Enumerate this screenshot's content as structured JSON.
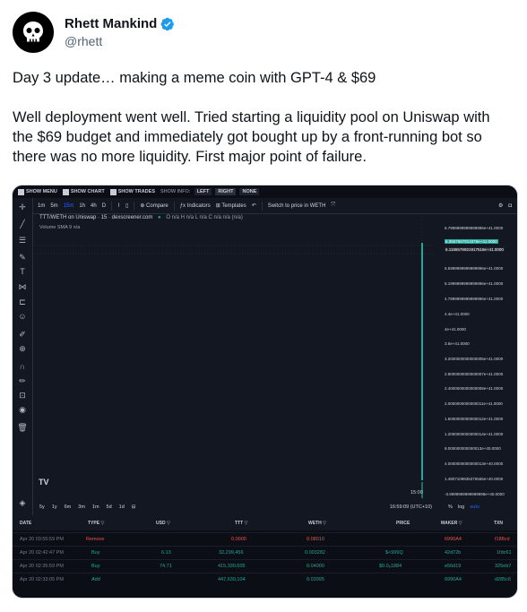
{
  "user": {
    "name": "Rhett Mankind",
    "handle": "@rhett",
    "verified_color": "#1d9bf0",
    "avatar_icon": "skull-icon"
  },
  "tweet": {
    "line1": "Day 3 update… making a meme coin with GPT-4 & $69",
    "line2": "Well deployment went well. Tried starting a liquidity pool on Uniswap with the $69 budget and immediately got bought up by a front-running bot so there was no more liquidity. First major point of failure."
  },
  "chart": {
    "topbar": {
      "show_menu": "SHOW MENU",
      "show_chart": "SHOW CHART",
      "show_trades": "SHOW TRADES",
      "show_info": "SHOW INFO:",
      "left": "LEFT",
      "right": "RIGHT",
      "none": "NONE"
    },
    "timeframes": [
      "1m",
      "5m",
      "15m",
      "1h",
      "4h",
      "D"
    ],
    "active_timeframe": "15m",
    "toolbar": {
      "compare": "Compare",
      "indicators": "Indicators",
      "templates": "Templates",
      "switch_price": "Switch to price in WETH"
    },
    "legend_title": "TTT/WETH on Uniswap · 15 · dexscreener.com",
    "legend_ohlc": "O n/a  H n/a  L n/a  C n/a  n/a (n/a)",
    "volume_label": "Volume  SMA 9  n/a",
    "watermark": "TV",
    "price_labels": [
      "6.7999999999999996e+41.0000",
      "6.3567567913376e+41.0000",
      "6.1186579921917518e+41.0000",
      "5.5999999999999996e+41.0000",
      "5.1999999999999996e+41.0000",
      "4.7999999999999996e+41.0000",
      "4.4e+41.0000",
      "4e+41.0000",
      "3.6e+41.0000",
      "3.2000000000000005e+41.0000",
      "2.8000000000000007e+41.0000",
      "2.4000000000000008e+41.0000",
      "2.0000000000000011e+41.0000",
      "1.6000000000000012e+41.0000",
      "1.2000000000000014e+41.0000",
      "8.000000000000013e+40.0000",
      "4.0000000000000013e+40.0000",
      "1.4807109835375555e+40.0000",
      "-3.9999999999999998e+40.0000"
    ],
    "time_label": "15:00",
    "ranges": [
      "5y",
      "1y",
      "6m",
      "3m",
      "1m",
      "5d",
      "1d"
    ],
    "clock": "16:59:09 (UTC+10)",
    "scale_opts": [
      "%",
      "log",
      "auto"
    ],
    "accent_color": "#26a69a"
  },
  "trades": {
    "headers": [
      "DATE",
      "TYPE",
      "USD",
      "TTT",
      "WETH",
      "PRICE",
      "MAKER",
      "TXN"
    ],
    "rows": [
      {
        "date": "Apr 20 03:55:59 PM",
        "type": "Remove",
        "usd": "",
        "ttt": "0.0000",
        "weth": "0.08010",
        "price": "",
        "maker": "6990A4",
        "txn": "f188cd",
        "kind": "sell"
      },
      {
        "date": "Apr 20 02:42:47 PM",
        "type": "Buy",
        "usd": "6.13",
        "ttt": "32,299,456",
        "weth": "0.003282",
        "price": "$<999Q",
        "maker": "42d72b",
        "txn": "1fdc61",
        "kind": "buy"
      },
      {
        "date": "Apr 20 02:35:59 PM",
        "type": "Buy",
        "usd": "74.71",
        "ttt": "415,330,605",
        "weth": "0.04000",
        "price": "$0.0₆1884",
        "maker": "e56d19",
        "txn": "325eb7",
        "kind": "buy"
      },
      {
        "date": "Apr 20 02:33:05 PM",
        "type": "Add",
        "usd": "",
        "ttt": "447,630,104",
        "weth": "0.03995",
        "price": "",
        "maker": "6990A4",
        "txn": "d285c6",
        "kind": "buy"
      }
    ]
  }
}
